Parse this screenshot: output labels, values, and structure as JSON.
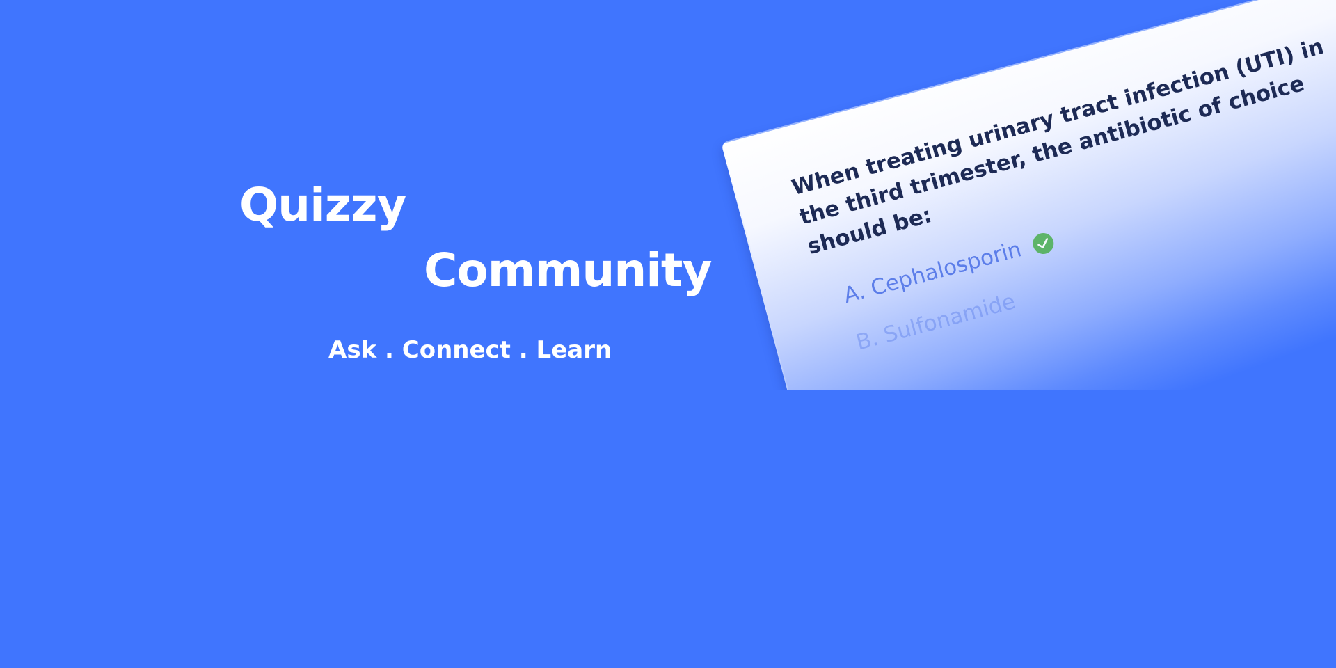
{
  "brand": {
    "title_line1": "Quizzy",
    "title_line2": "Community",
    "tagline": "Ask . Connect . Learn"
  },
  "quiz_card": {
    "question": "When treating urinary tract infection (UTI) in the third trimester, the antibiotic of choice should be:",
    "options": [
      {
        "label": "A. Cephalosporin",
        "correct": true,
        "icon": "check-circle-icon"
      },
      {
        "label": "B. Sulfonamide",
        "correct": false
      }
    ]
  },
  "colors": {
    "background": "#4075fe",
    "text": "#ffffff",
    "question_text": "#1d2a55",
    "option_text": "#4a6fe6",
    "correct_badge": "#4caf50"
  }
}
